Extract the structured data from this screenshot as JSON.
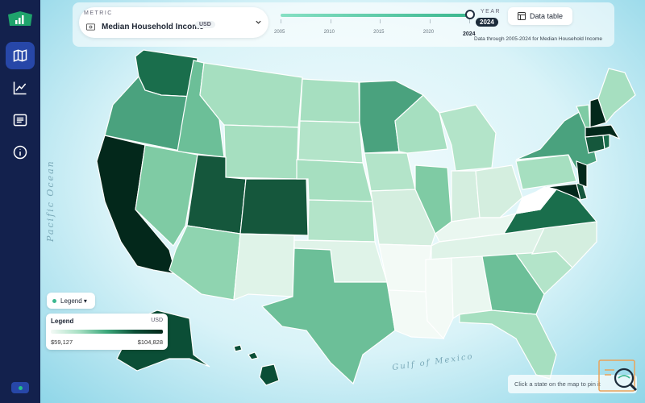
{
  "sidebar": {
    "items": [
      {
        "name": "map-icon",
        "active": true
      },
      {
        "name": "line-chart-icon",
        "active": false
      },
      {
        "name": "list-icon",
        "active": false
      },
      {
        "name": "info-icon",
        "active": false
      }
    ],
    "logo": "bar-chart-logo-icon"
  },
  "metric": {
    "caption": "METRIC",
    "value": "Median Household Income",
    "unit": "USD",
    "icon": "currency-icon"
  },
  "year": {
    "caption": "YEAR",
    "selected": "2024",
    "ticks": [
      "2005",
      "2010",
      "2015",
      "2020",
      "2024"
    ],
    "range": [
      2005,
      2024
    ],
    "note": "Data through 2005-2024 for Median Household Income"
  },
  "toolbar": {
    "data_table_label": "Data table"
  },
  "legend": {
    "toggle_label": "Legend ▾",
    "title": "Legend",
    "unit": "USD",
    "min_label": "$59,127",
    "max_label": "$104,828"
  },
  "ocean_labels": {
    "pacific": "Pacific Ocean",
    "gulf": "Gulf of Mexico"
  },
  "hint": "Click a state on the map to pin it",
  "colors": {
    "sidebar": "#13214d",
    "accent": "#2747a8",
    "scale_low": "#f3faf6",
    "scale_high": "#03281b"
  }
}
